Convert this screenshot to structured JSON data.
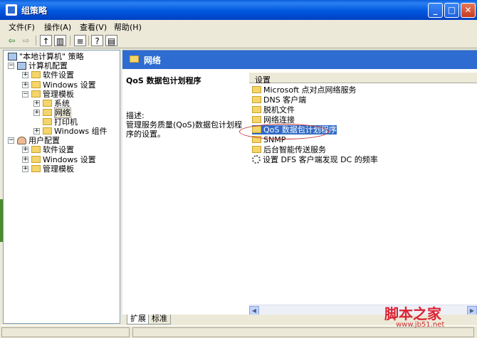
{
  "window": {
    "title": "组策略",
    "min_icon": "minimize-icon",
    "max_icon": "maximize-icon",
    "close_icon": "close-icon"
  },
  "menu": [
    "文件(F)",
    "操作(A)",
    "查看(V)",
    "帮助(H)"
  ],
  "tree": {
    "root": "\"本地计算机\" 策略",
    "computer_config": "计算机配置",
    "cc_software": "软件设置",
    "cc_windows": "Windows 设置",
    "cc_admin": "管理模板",
    "cc_system": "系统",
    "cc_network": "网络",
    "cc_printer": "打印机",
    "cc_wincomp": "Windows 组件",
    "user_config": "用户配置",
    "uc_software": "软件设置",
    "uc_windows": "Windows 设置",
    "uc_admin": "管理模板"
  },
  "right": {
    "header": "网络",
    "desc_title": "QoS 数据包计划程序",
    "desc_label": "描述:",
    "desc_text": "管理服务质量(QoS)数据包计划程序的设置。",
    "column": "设置",
    "items": [
      "Microsoft 点对点网络服务",
      "DNS 客户端",
      "脱机文件",
      "网络连接",
      "QoS 数据包计划程序",
      "SNMP",
      "后台智能传送服务",
      "设置 DFS 客户端发现 DC 的频率"
    ],
    "selected_index": 4
  },
  "tabs": [
    "扩展",
    "标准"
  ],
  "watermark": {
    "text": "脚本之家",
    "url": "www.jb51.net"
  }
}
